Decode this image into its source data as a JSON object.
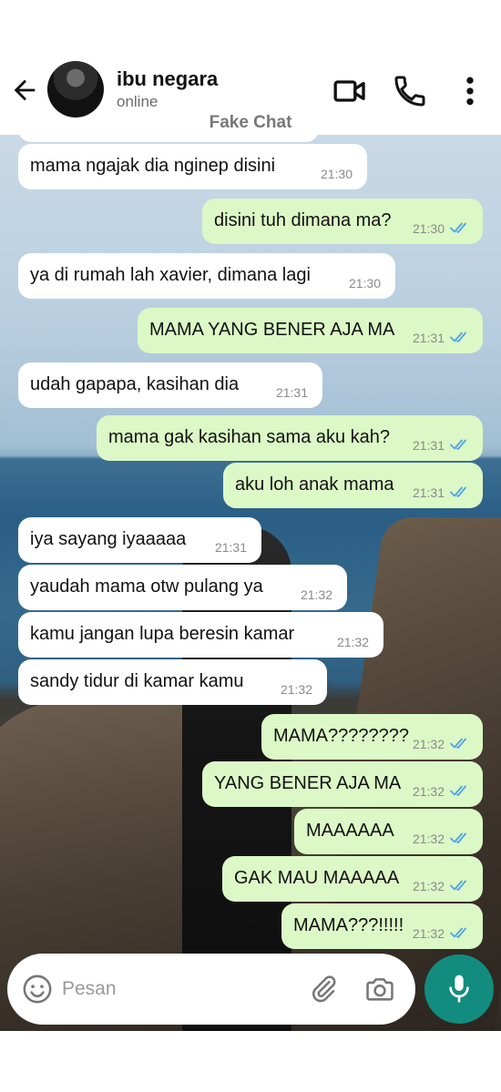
{
  "header": {
    "contact_name": "ibu negara",
    "status": "online",
    "watermark": "Fake Chat",
    "icons": [
      "back-arrow-icon",
      "video-call-icon",
      "phone-icon",
      "more-vertical-icon"
    ]
  },
  "messages": [
    {
      "dir": "in",
      "text": "mama ngajak dia nginep disini",
      "time": "21:30"
    },
    {
      "dir": "out",
      "text": "disini tuh dimana ma?",
      "time": "21:30",
      "read": true
    },
    {
      "dir": "in",
      "text": "ya di rumah lah xavier, dimana lagi",
      "time": "21:30"
    },
    {
      "dir": "out",
      "text": "MAMA YANG BENER AJA MA",
      "time": "21:31",
      "read": true
    },
    {
      "dir": "in",
      "text": "udah gapapa, kasihan dia",
      "time": "21:31"
    },
    {
      "dir": "out",
      "text": "mama gak kasihan sama aku kah?",
      "time": "21:31",
      "read": true
    },
    {
      "dir": "out",
      "text": "aku loh anak mama",
      "time": "21:31",
      "read": true
    },
    {
      "dir": "in",
      "text": "iya sayang iyaaaaa",
      "time": "21:31"
    },
    {
      "dir": "in",
      "text": "yaudah mama otw pulang ya",
      "time": "21:32"
    },
    {
      "dir": "in",
      "text": "kamu jangan lupa beresin kamar",
      "time": "21:32"
    },
    {
      "dir": "in",
      "text": "sandy tidur di kamar kamu",
      "time": "21:32"
    },
    {
      "dir": "out",
      "text": "MAMA????????",
      "time": "21:32",
      "read": true
    },
    {
      "dir": "out",
      "text": "YANG BENER AJA MA",
      "time": "21:32",
      "read": true
    },
    {
      "dir": "out",
      "text": "MAAAAAA",
      "time": "21:32",
      "read": true
    },
    {
      "dir": "out",
      "text": "GAK MAU MAAAAA",
      "time": "21:32",
      "read": true
    },
    {
      "dir": "out",
      "text": "MAMA???!!!!!",
      "time": "21:32",
      "read": true
    }
  ],
  "input": {
    "placeholder": "Pesan"
  },
  "colors": {
    "outgoing_bubble": "#dcf8c6",
    "incoming_bubble": "#ffffff",
    "read_tick": "#4fc3f7",
    "mic_button": "#128c7e"
  }
}
